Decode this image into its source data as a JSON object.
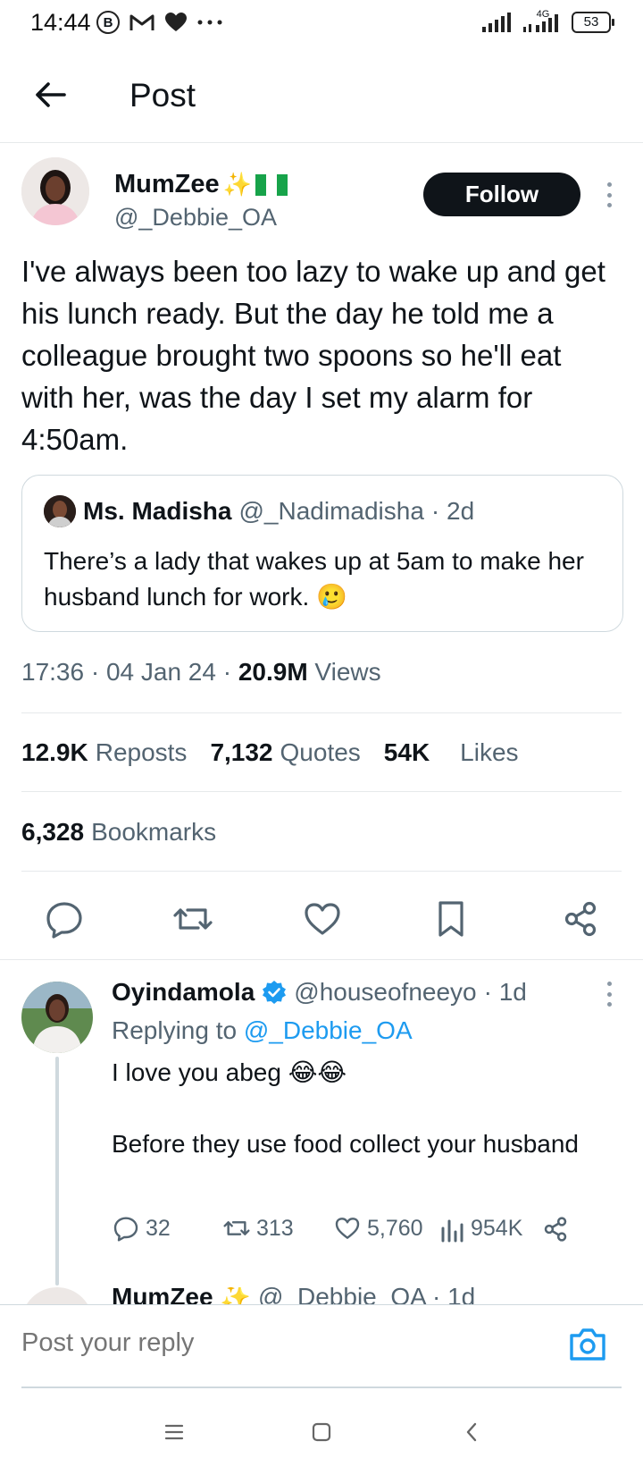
{
  "status_bar": {
    "time": "14:44",
    "b_icon": "B",
    "network": "4G",
    "battery": "53",
    "icons": [
      "b-circle-icon",
      "gmail-icon",
      "heart-icon",
      "more-dots-icon",
      "signal-icon",
      "signal-4g-icon",
      "battery-icon"
    ]
  },
  "header": {
    "title": "Post",
    "back_icon": "arrow-left-icon"
  },
  "post": {
    "author_name": "MumZee",
    "author_emojis": "✨",
    "author_flag": "nigeria-flag-icon",
    "author_handle": "@_Debbie_OA",
    "follow_label": "Follow",
    "text": "I've always been too lazy to wake up and get his lunch ready. But the day he told me a colleague brought two spoons so he'll eat with her, was the day I set my alarm for 4:50am.",
    "quote": {
      "name": "Ms. Madisha",
      "handle": "@_Nadimadisha",
      "time": "· 2d",
      "text": "There’s a lady that wakes up at 5am to make her husband lunch for work. 🥲"
    },
    "time": "17:36 · 04 Jan 24 · ",
    "views_count": "20.9M",
    "views_label": " Views",
    "stats": {
      "reposts_count": "12.9K",
      "reposts_label": "Reposts",
      "quotes_count": "7,132",
      "quotes_label": "Quotes",
      "likes_count": "54K",
      "likes_label": "Likes",
      "bookmarks_count": "6,328",
      "bookmarks_label": "Bookmarks"
    },
    "actions": [
      "reply-icon",
      "repost-icon",
      "like-icon",
      "bookmark-icon",
      "share-icon"
    ]
  },
  "reply": {
    "name": "Oyindamola",
    "verified_icon": "verified-badge-icon",
    "handle": "@houseofneeyo",
    "time": "· 1d",
    "replying_prefix": "Replying to ",
    "replying_handle": "@_Debbie_OA",
    "text": "I love you abeg 😂😂\n\nBefore they use food collect your husband",
    "reply_count": "32",
    "repost_count": "313",
    "like_count": "5,760",
    "views_count": "954K"
  },
  "next_reply": {
    "name": "MumZee",
    "handle": "@_Debbie_OA · 1d"
  },
  "composer": {
    "placeholder": "Post your reply",
    "camera_icon": "camera-icon"
  },
  "navbar": {
    "icons": [
      "menu-icon",
      "home-square-icon",
      "back-chevron-icon"
    ]
  },
  "colors": {
    "accent": "#1d9bf0",
    "text": "#0f1419",
    "muted": "#536471",
    "border": "#cfd9de"
  }
}
